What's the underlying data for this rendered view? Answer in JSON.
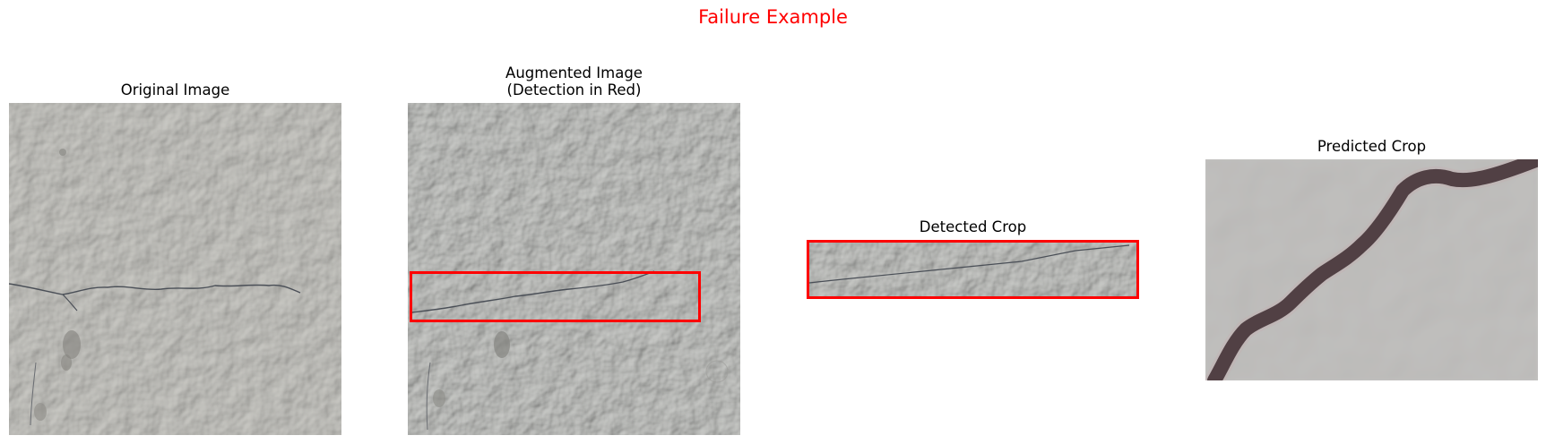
{
  "figure": {
    "suptitle": "Failure Example",
    "suptitle_color": "#ff0000"
  },
  "panels": {
    "original": {
      "title": "Original Image"
    },
    "augmented": {
      "title_line1": "Augmented Image",
      "title_line2": "(Detection in Red)"
    },
    "detected": {
      "title": "Detected Crop"
    },
    "predicted": {
      "title": "Predicted Crop"
    }
  },
  "colors": {
    "concrete": "#bdbcb8",
    "crack": "#4a4f57",
    "detection_box": "#ff0000"
  }
}
